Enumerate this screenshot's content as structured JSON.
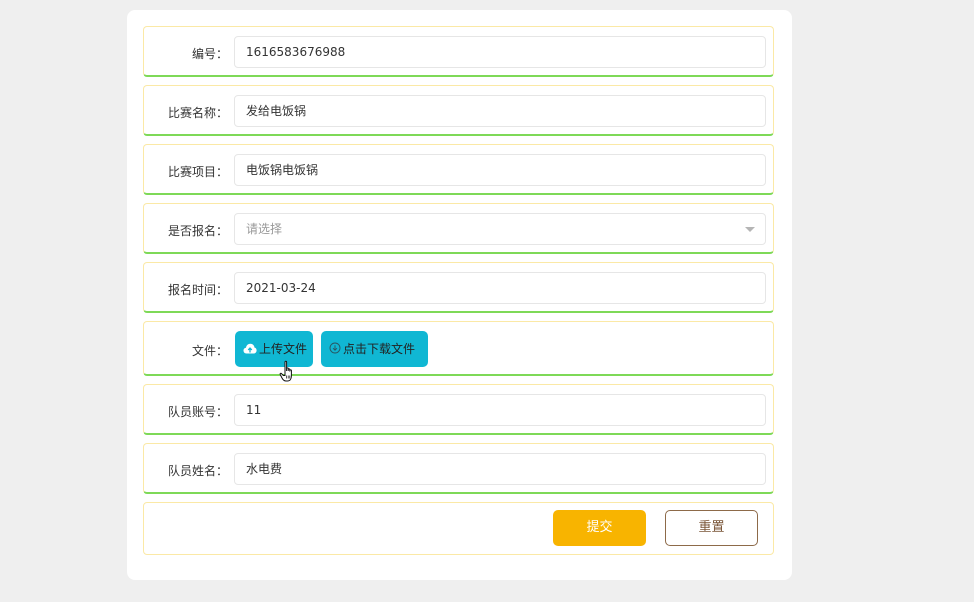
{
  "form": {
    "fields": [
      {
        "label": "编号：",
        "value": "1616583676988"
      },
      {
        "label": "比赛名称：",
        "value": "发给电饭锅"
      },
      {
        "label": "比赛项目：",
        "value": "电饭锅电饭锅"
      },
      {
        "label": "是否报名：",
        "placeholder": "请选择"
      },
      {
        "label": "报名时间：",
        "value": "2021-03-24"
      },
      {
        "label": "文件：",
        "upload_label": "上传文件",
        "download_label": "点击下载文件"
      },
      {
        "label": "队员账号：",
        "value": "11"
      },
      {
        "label": "队员姓名：",
        "value": "水电费"
      }
    ],
    "actions": {
      "submit_label": "提交",
      "reset_label": "重置"
    }
  },
  "colors": {
    "file_button": "#10b7d3",
    "submit": "#f8b400",
    "reset_border": "#8d6a49",
    "row_bottom_border": "#7ed957",
    "row_border": "#fbe9a6"
  },
  "icons": [
    "cloud-upload-icon",
    "download-circle-icon",
    "hand-pointer-icon"
  ]
}
